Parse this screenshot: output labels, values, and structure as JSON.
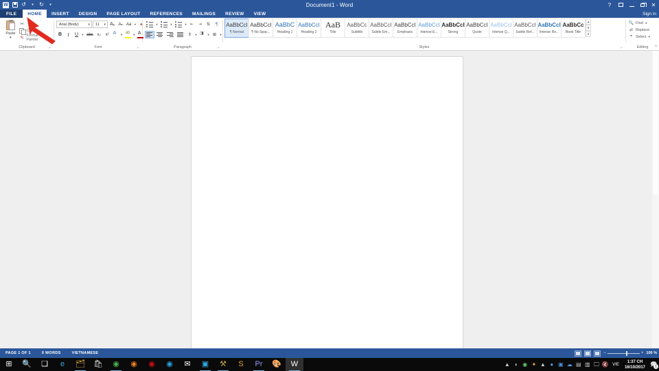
{
  "titlebar": {
    "title": "Document1 - Word",
    "qat": [
      {
        "name": "word-logo-icon",
        "label": "W"
      },
      {
        "name": "save-icon",
        "label": "Save"
      },
      {
        "name": "undo-icon",
        "label": "↺"
      },
      {
        "name": "undo-dropdown-icon",
        "label": "▾"
      },
      {
        "name": "redo-icon",
        "label": "↻"
      },
      {
        "name": "customize-qat-icon",
        "label": "▾"
      }
    ],
    "window_buttons": [
      {
        "name": "help-button",
        "label": "?"
      },
      {
        "name": "ribbon-display-options-button",
        "label": "▭"
      },
      {
        "name": "minimize-button",
        "label": "—"
      },
      {
        "name": "restore-button",
        "label": "❐"
      },
      {
        "name": "close-button",
        "label": "✕"
      }
    ],
    "signin": "Sign in"
  },
  "tabs": [
    {
      "label": "FILE",
      "state": "file"
    },
    {
      "label": "HOME",
      "state": "active"
    },
    {
      "label": "INSERT",
      "state": "normal"
    },
    {
      "label": "DESIGN",
      "state": "normal"
    },
    {
      "label": "PAGE LAYOUT",
      "state": "normal"
    },
    {
      "label": "REFERENCES",
      "state": "normal"
    },
    {
      "label": "MAILINGS",
      "state": "normal"
    },
    {
      "label": "REVIEW",
      "state": "normal"
    },
    {
      "label": "VIEW",
      "state": "normal"
    }
  ],
  "ribbon": {
    "collapse_label": "^",
    "clipboard": {
      "label": "Clipboard",
      "paste_label": "Paste",
      "paste_arrow": "▾",
      "dialog_launcher": "⌐",
      "items": [
        {
          "icon": "cut-icon",
          "label": "Cut",
          "glyph": "✂"
        },
        {
          "icon": "copy-icon",
          "label": "Copy",
          "glyph": ""
        },
        {
          "icon": "format-painter-icon",
          "label": "Format Painter",
          "glyph": "🖌"
        }
      ]
    },
    "font": {
      "label": "Font",
      "dialog_launcher": "⌐",
      "font_name": "Arial (Body)",
      "font_size": "11",
      "grow_font": "A",
      "shrink_font": "A",
      "change_case": "Aa",
      "clear_formatting": "✦",
      "bold": "B",
      "italic": "I",
      "underline": "U",
      "strikethrough": "abc",
      "subscript": "x₂",
      "superscript": "x²",
      "text_effects": "A",
      "highlight": "ab",
      "font_color": "A",
      "caret": "▾"
    },
    "paragraph": {
      "label": "Paragraph",
      "dialog_launcher": "⌐",
      "buttons": [
        {
          "name": "bullets-button",
          "caret": "▾"
        },
        {
          "name": "numbering-button",
          "caret": "▾"
        },
        {
          "name": "multilevel-list-button",
          "caret": "▾"
        },
        {
          "name": "decrease-indent-button",
          "caret": ""
        },
        {
          "name": "increase-indent-button",
          "caret": ""
        },
        {
          "name": "sort-button",
          "caret": ""
        },
        {
          "name": "show-formatting-marks-button",
          "caret": ""
        },
        {
          "name": "align-left-button",
          "caret": ""
        },
        {
          "name": "align-center-button",
          "caret": ""
        },
        {
          "name": "align-right-button",
          "caret": ""
        },
        {
          "name": "justify-button",
          "caret": ""
        },
        {
          "name": "line-spacing-button",
          "caret": "▾"
        },
        {
          "name": "shading-button",
          "caret": "▾"
        },
        {
          "name": "borders-button",
          "caret": "▾"
        }
      ]
    },
    "styles": {
      "label": "Styles",
      "dialog_launcher": "⌐",
      "scroll_up": "▴",
      "scroll_down": "▾",
      "more": "▾",
      "items": [
        {
          "preview": "AaBbCcI",
          "label": "¶ Normal",
          "selected": true,
          "color": "#3b3b3b",
          "bold": false,
          "size": 8
        },
        {
          "preview": "AaBbCcI",
          "label": "¶ No Spac...",
          "selected": false,
          "color": "#3b3b3b",
          "bold": false,
          "size": 8
        },
        {
          "preview": "AaBbC",
          "label": "Heading 1",
          "selected": false,
          "color": "#2e74b5",
          "bold": false,
          "size": 9
        },
        {
          "preview": "AaBbCcI",
          "label": "Heading 2",
          "selected": false,
          "color": "#2e74b5",
          "bold": false,
          "size": 8
        },
        {
          "preview": "AaB",
          "label": "Title",
          "selected": false,
          "color": "#2b2b2b",
          "bold": false,
          "size": 12
        },
        {
          "preview": "AaBbCc",
          "label": "Subtitle",
          "selected": false,
          "color": "#5a5a5a",
          "bold": false,
          "size": 8
        },
        {
          "preview": "AaBbCcI",
          "label": "Subtle Em...",
          "selected": false,
          "color": "#5a5a5a",
          "bold": false,
          "size": 8
        },
        {
          "preview": "AaBbCcI",
          "label": "Emphasis",
          "selected": false,
          "color": "#3b3b3b",
          "bold": false,
          "size": 8
        },
        {
          "preview": "AaBbCcI",
          "label": "Intense E...",
          "selected": false,
          "color": "#5b9bd5",
          "bold": false,
          "size": 8
        },
        {
          "preview": "AaBbCcI",
          "label": "Strong",
          "selected": false,
          "color": "#2b2b2b",
          "bold": true,
          "size": 8
        },
        {
          "preview": "AaBbCcI",
          "label": "Quote",
          "selected": false,
          "color": "#3b3b3b",
          "bold": false,
          "size": 8
        },
        {
          "preview": "AaBbCcI",
          "label": "Intense Q...",
          "selected": false,
          "color": "#9cc3e5",
          "bold": false,
          "size": 8
        },
        {
          "preview": "AaBbCcI",
          "label": "Subtle Ref...",
          "selected": false,
          "color": "#5a5a5a",
          "bold": false,
          "size": 8
        },
        {
          "preview": "AaBbCcI",
          "label": "Intense Re...",
          "selected": false,
          "color": "#2e74b5",
          "bold": true,
          "size": 8
        },
        {
          "preview": "AaBbCc",
          "label": "Book Title",
          "selected": false,
          "color": "#2b2b2b",
          "bold": true,
          "size": 8
        }
      ]
    },
    "editing": {
      "label": "Editing",
      "items": [
        {
          "name": "find-button",
          "label": "Find",
          "caret": "▾",
          "glyph": "🔍"
        },
        {
          "name": "replace-button",
          "label": "Replace",
          "caret": "",
          "glyph": "⇄"
        },
        {
          "name": "select-button",
          "label": "Select",
          "caret": "▾",
          "glyph": "⌖"
        }
      ]
    }
  },
  "statusbar": {
    "page": "PAGE 1 OF 1",
    "words": "0 WORDS",
    "language": "VIETNAMESE",
    "views": [
      {
        "name": "read-mode-button",
        "active": false
      },
      {
        "name": "print-layout-button",
        "active": true
      },
      {
        "name": "web-layout-button",
        "active": false
      }
    ],
    "zoom_out": "−",
    "zoom_in": "+",
    "zoom_value": "100 %"
  },
  "taskbar": {
    "items": [
      {
        "name": "start-button",
        "glyph": "⊞",
        "color": "#ffffff",
        "running": false,
        "active": false
      },
      {
        "name": "search-icon",
        "glyph": "🔍",
        "color": "#ffffff",
        "running": false,
        "active": false
      },
      {
        "name": "task-view-icon",
        "glyph": "❑",
        "color": "#ffffff",
        "running": false,
        "active": false
      },
      {
        "name": "edge-icon",
        "glyph": "e",
        "color": "#3ba7e0",
        "running": false,
        "active": false
      },
      {
        "name": "file-explorer-icon",
        "glyph": "🗂",
        "color": "#e8b44a",
        "running": true,
        "active": false
      },
      {
        "name": "store-icon",
        "glyph": "🛍",
        "color": "#dddddd",
        "running": false,
        "active": false
      },
      {
        "name": "chrome-icon",
        "glyph": "◉",
        "color": "#4caf50",
        "running": true,
        "active": false
      },
      {
        "name": "firefox-icon",
        "glyph": "◉",
        "color": "#e8821e",
        "running": false,
        "active": false
      },
      {
        "name": "opera-icon",
        "glyph": "◉",
        "color": "#cc0f16",
        "running": false,
        "active": false
      },
      {
        "name": "coccoc-icon",
        "glyph": "◉",
        "color": "#2a9fd6",
        "running": false,
        "active": false
      },
      {
        "name": "mail-icon",
        "glyph": "✉",
        "color": "#ffffff",
        "running": false,
        "active": false
      },
      {
        "name": "photoshop-icon",
        "glyph": "▣",
        "color": "#31a8e0",
        "running": true,
        "active": false
      },
      {
        "name": "tools-icon",
        "glyph": "⚒",
        "color": "#c8a24a",
        "running": true,
        "active": false
      },
      {
        "name": "sublime-icon",
        "glyph": "S",
        "color": "#e8a33d",
        "running": false,
        "active": false
      },
      {
        "name": "premiere-icon",
        "glyph": "Pr",
        "color": "#9999ff",
        "running": true,
        "active": false
      },
      {
        "name": "paint-icon",
        "glyph": "🎨",
        "color": "#dd8844",
        "running": false,
        "active": false
      },
      {
        "name": "word-taskbar-icon",
        "glyph": "W",
        "color": "#ffffff",
        "running": true,
        "active": true
      }
    ],
    "tray": [
      {
        "name": "tray-show-hidden-icon",
        "glyph": "▲",
        "color": "#cccccc"
      },
      {
        "name": "tray-app1-icon",
        "glyph": "◗",
        "color": "#cccccc"
      },
      {
        "name": "tray-app2-icon",
        "glyph": "◉",
        "color": "#66cc66"
      },
      {
        "name": "tray-unikey-icon",
        "glyph": "✦",
        "color": "#e8b44a"
      },
      {
        "name": "tray-app4-icon",
        "glyph": "▲",
        "color": "#cccccc"
      },
      {
        "name": "tray-app5-icon",
        "glyph": "●",
        "color": "#5599dd"
      },
      {
        "name": "tray-app6-icon",
        "glyph": "▣",
        "color": "#4a8fd4"
      },
      {
        "name": "tray-onedrive-icon",
        "glyph": "☁",
        "color": "#5599dd"
      },
      {
        "name": "tray-app8-icon",
        "glyph": "▤",
        "color": "#bbbbbb"
      },
      {
        "name": "tray-app9-icon",
        "glyph": "▥",
        "color": "#cccccc"
      },
      {
        "name": "tray-network-icon",
        "glyph": "🖵",
        "color": "#cccccc"
      },
      {
        "name": "tray-volume-icon",
        "glyph": "🔇",
        "color": "#cccccc"
      }
    ],
    "language": "VIE",
    "time": "1:37 CH",
    "date": "16/10/2017",
    "notification_count": "1"
  },
  "annotation": {
    "arrow_color": "#e02b1e",
    "name": "red-arrow-annotation"
  },
  "colors": {
    "word_blue": "#2b579a",
    "file_tab_blue": "#1e3f72",
    "doc_bg": "#efefef"
  }
}
